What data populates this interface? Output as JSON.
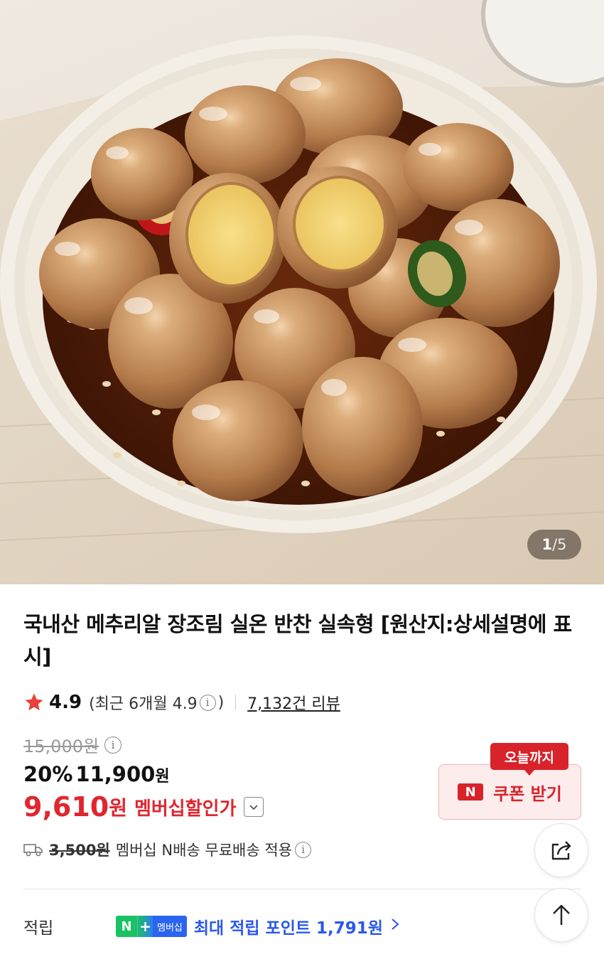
{
  "hero": {
    "image_alt": "quail eggs in soy braise",
    "counter": {
      "current": "1",
      "separator": "/",
      "total": "5"
    }
  },
  "product": {
    "title": "국내산 메추리알 장조림 실온 반찬 실속형 [원산지:상세설명에 표시]"
  },
  "rating": {
    "score": "4.9",
    "recent_prefix": "(최근 6개월 4.9",
    "recent_suffix": ")",
    "reviews": "7,132건 리뷰"
  },
  "price": {
    "original": "15,000원",
    "discount_pct": "20%",
    "sale": "11,900",
    "sale_unit": "원",
    "member": "9,610",
    "member_unit": "원",
    "member_label": "멤버십할인가"
  },
  "shipping": {
    "fee": "3,500원",
    "text": "멤버십 N배송 무료배송 적용"
  },
  "points": {
    "label": "적립",
    "badge_n": "N",
    "badge_plus": "+",
    "badge_member": "멤버십",
    "desc": "최대 적립 포인트",
    "amount": "1,791원"
  },
  "coupon": {
    "tag": "오늘까지",
    "logo": "N",
    "button": "쿠폰 받기"
  },
  "colors": {
    "accent_red": "#e0262f",
    "points_blue": "#2b58e8",
    "naver_green": "#19c263"
  },
  "icons": [
    "star-icon",
    "info-icon",
    "chevron-down-icon",
    "truck-icon",
    "chevron-right-icon",
    "share-icon",
    "arrow-up-icon"
  ]
}
